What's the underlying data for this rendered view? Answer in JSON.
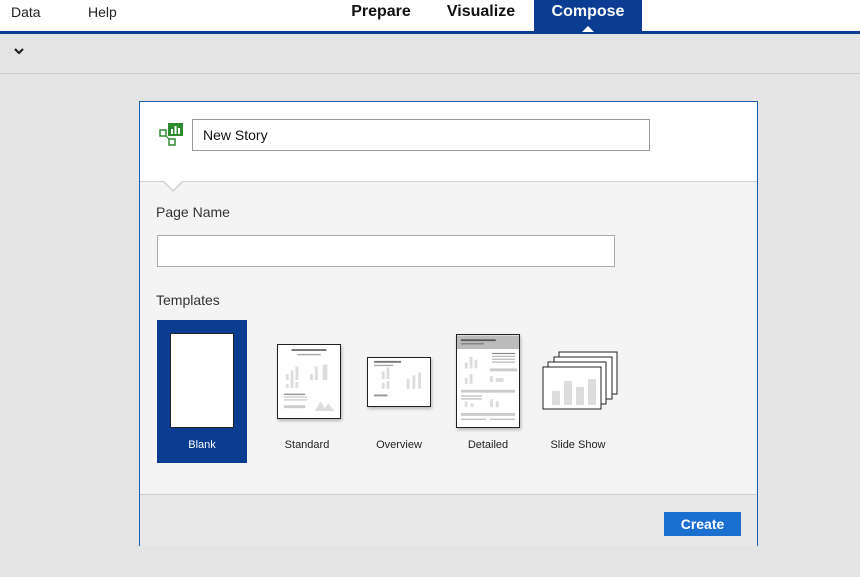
{
  "menu": {
    "data_label": "Data",
    "help_label": "Help"
  },
  "modes": {
    "prepare": "Prepare",
    "visualize": "Visualize",
    "compose": "Compose",
    "active": "Compose"
  },
  "toolbar": {
    "chevron_icon": "chevron-down-icon"
  },
  "dialog": {
    "story_icon": "story-icon",
    "story_name_value": "New Story",
    "page_name_label": "Page Name",
    "page_name_value": "",
    "templates_label": "Templates",
    "templates": [
      {
        "label": "Blank",
        "selected": true
      },
      {
        "label": "Standard",
        "selected": false
      },
      {
        "label": "Overview",
        "selected": false
      },
      {
        "label": "Detailed",
        "selected": false
      },
      {
        "label": "Slide Show",
        "selected": false
      }
    ],
    "create_label": "Create"
  },
  "colors": {
    "accent": "#0a3d91",
    "button": "#1a6fd1",
    "icon_green": "#2e8b2e"
  }
}
